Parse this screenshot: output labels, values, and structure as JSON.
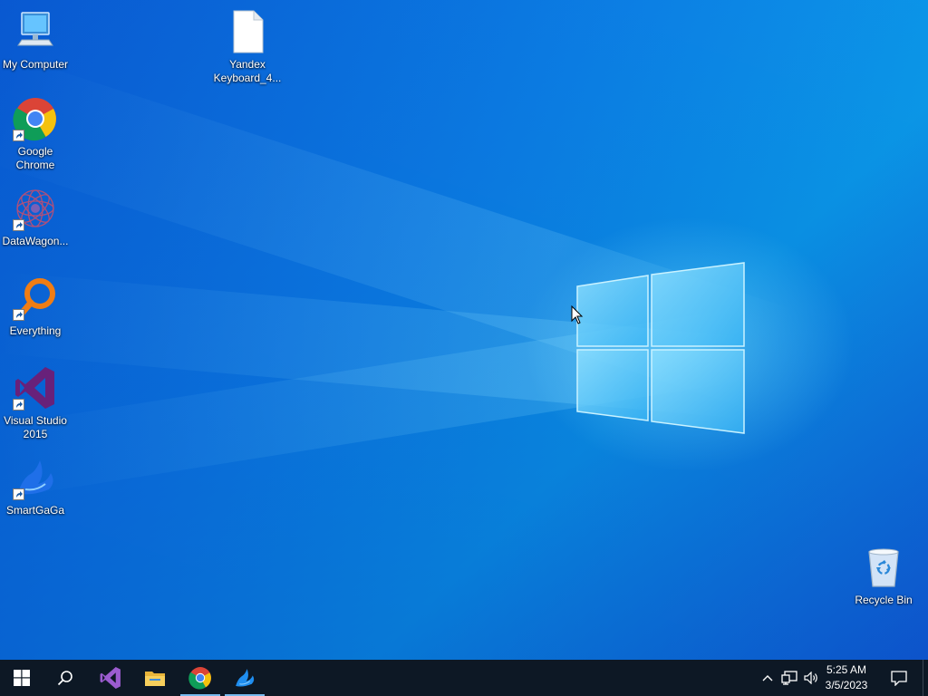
{
  "desktop": {
    "icons": [
      {
        "label": "My Computer",
        "icon": "computer-icon"
      },
      {
        "label": "Google\nChrome",
        "icon": "chrome-icon",
        "shortcut": true
      },
      {
        "label": "DataWagon...",
        "icon": "datawagon-icon",
        "shortcut": true
      },
      {
        "label": "Everything",
        "icon": "everything-icon",
        "shortcut": true
      },
      {
        "label": "Visual Studio\n2015",
        "icon": "visual-studio-icon",
        "shortcut": true
      },
      {
        "label": "SmartGaGa",
        "icon": "smartgaga-icon",
        "shortcut": true
      },
      {
        "label": "Yandex\nKeyboard_4...",
        "icon": "file-icon"
      },
      {
        "label": "Recycle Bin",
        "icon": "recycle-bin-icon"
      }
    ]
  },
  "taskbar": {
    "start": {
      "icon": "windows-start-icon"
    },
    "search": {
      "icon": "search-icon"
    },
    "pinned": [
      {
        "icon": "visual-studio-icon",
        "running": false
      },
      {
        "icon": "file-explorer-icon",
        "running": false
      },
      {
        "icon": "chrome-icon",
        "running": true
      },
      {
        "icon": "smartgaga-icon",
        "running": true
      }
    ],
    "tray": {
      "icons": [
        "show-hidden-icons-icon",
        "network-icon",
        "volume-icon"
      ],
      "time": "5:25 AM",
      "date": "3/5/2023",
      "notifications_icon": "action-center-icon"
    }
  },
  "colors": {
    "desktop_blue": "#0c82e6",
    "taskbar": "#0d1825",
    "running_indicator": "#76b9ed"
  }
}
